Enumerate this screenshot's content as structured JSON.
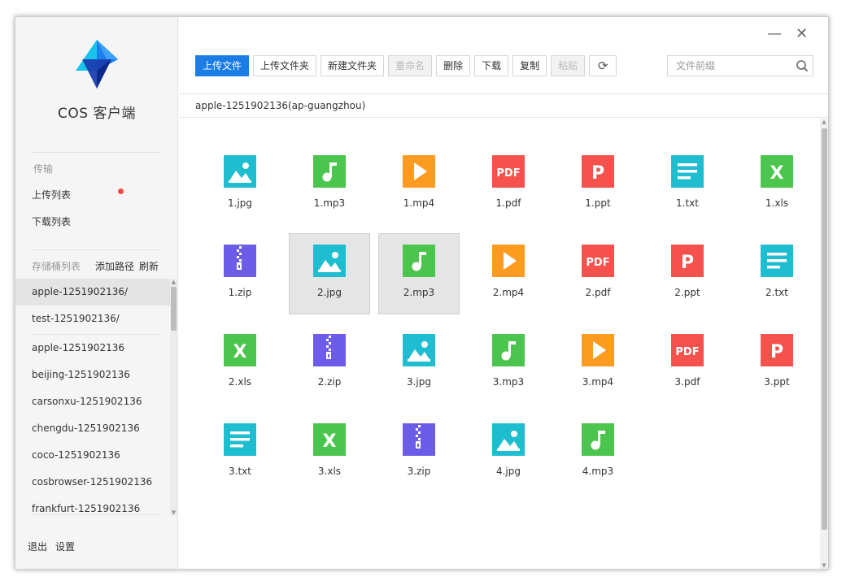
{
  "app": {
    "title": "COS 客户端"
  },
  "sidebar": {
    "transfer_label": "传输",
    "upload_list": "上传列表",
    "download_list": "下载列表",
    "bucket_list_label": "存储桶列表",
    "add_path": "添加路径",
    "refresh": "刷新",
    "paths": [
      "apple-1251902136/",
      "test-1251902136/"
    ],
    "buckets": [
      "apple-1251902136",
      "beijing-1251902136",
      "carsonxu-1251902136",
      "chengdu-1251902136",
      "coco-1251902136",
      "cosbrowser-1251902136",
      "frankfurt-1251902136"
    ],
    "logout": "退出",
    "settings": "设置"
  },
  "toolbar": {
    "upload_file": "上传文件",
    "upload_folder": "上传文件夹",
    "new_folder": "新建文件夹",
    "rename": "重命名",
    "delete": "删除",
    "download": "下载",
    "copy": "复制",
    "paste": "粘贴",
    "refresh_icon": "refresh-icon"
  },
  "search": {
    "placeholder": "文件前缀"
  },
  "path": "apple-1251902136(ap-guangzhou)",
  "colors": {
    "image": "#1fbdd0",
    "audio": "#4cc54f",
    "video": "#fd9a20",
    "pdf": "#f5514d",
    "ppt": "#f5514d",
    "txt": "#1fbdd0",
    "xls": "#4cc54f",
    "zip": "#6c5ce7",
    "primary": "#1c7ce5"
  },
  "files": [
    {
      "name": "1.jpg",
      "type": "image",
      "selected": false
    },
    {
      "name": "1.mp3",
      "type": "audio",
      "selected": false
    },
    {
      "name": "1.mp4",
      "type": "video",
      "selected": false
    },
    {
      "name": "1.pdf",
      "type": "pdf",
      "selected": false
    },
    {
      "name": "1.ppt",
      "type": "ppt",
      "selected": false
    },
    {
      "name": "1.txt",
      "type": "txt",
      "selected": false
    },
    {
      "name": "1.xls",
      "type": "xls",
      "selected": false
    },
    {
      "name": "1.zip",
      "type": "zip",
      "selected": false
    },
    {
      "name": "2.jpg",
      "type": "image",
      "selected": true
    },
    {
      "name": "2.mp3",
      "type": "audio",
      "selected": true
    },
    {
      "name": "2.mp4",
      "type": "video",
      "selected": false
    },
    {
      "name": "2.pdf",
      "type": "pdf",
      "selected": false
    },
    {
      "name": "2.ppt",
      "type": "ppt",
      "selected": false
    },
    {
      "name": "2.txt",
      "type": "txt",
      "selected": false
    },
    {
      "name": "2.xls",
      "type": "xls",
      "selected": false
    },
    {
      "name": "2.zip",
      "type": "zip",
      "selected": false
    },
    {
      "name": "3.jpg",
      "type": "image",
      "selected": false
    },
    {
      "name": "3.mp3",
      "type": "audio",
      "selected": false
    },
    {
      "name": "3.mp4",
      "type": "video",
      "selected": false
    },
    {
      "name": "3.pdf",
      "type": "pdf",
      "selected": false
    },
    {
      "name": "3.ppt",
      "type": "ppt",
      "selected": false
    },
    {
      "name": "3.txt",
      "type": "txt",
      "selected": false
    },
    {
      "name": "3.xls",
      "type": "xls",
      "selected": false
    },
    {
      "name": "3.zip",
      "type": "zip",
      "selected": false
    },
    {
      "name": "4.jpg",
      "type": "image",
      "selected": false
    },
    {
      "name": "4.mp3",
      "type": "audio",
      "selected": false
    }
  ]
}
